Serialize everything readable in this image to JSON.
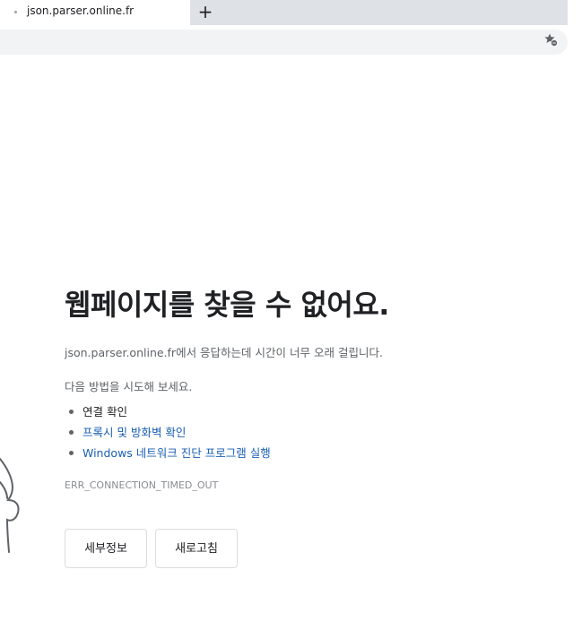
{
  "browser": {
    "tab": {
      "title": "json.parser.online.fr"
    },
    "new_tab_label": "+"
  },
  "error_page": {
    "heading": "웹페이지를 찾을 수 없어요.",
    "description": "json.parser.online.fr에서 응답하는데 시간이 너무 오래 걸립니다.",
    "try_label": "다음 방법을 시도해 보세요.",
    "suggestions": [
      {
        "label": "연결 확인",
        "is_link": false
      },
      {
        "label": "프록시 및 방화벽 확인",
        "is_link": true
      },
      {
        "label": "Windows 네트워크 진단 프로그램 실행",
        "is_link": true
      }
    ],
    "error_code": "ERR_CONNECTION_TIMED_OUT",
    "buttons": {
      "details": "세부정보",
      "reload": "새로고침"
    }
  },
  "icons": {
    "bookmark": "bookmark-star-icon",
    "dino": "dino-icon"
  },
  "colors": {
    "link": "#1a5fb4",
    "text": "#202124",
    "secondary_text": "#5f6368",
    "tabbar_bg": "#dee1e6"
  }
}
